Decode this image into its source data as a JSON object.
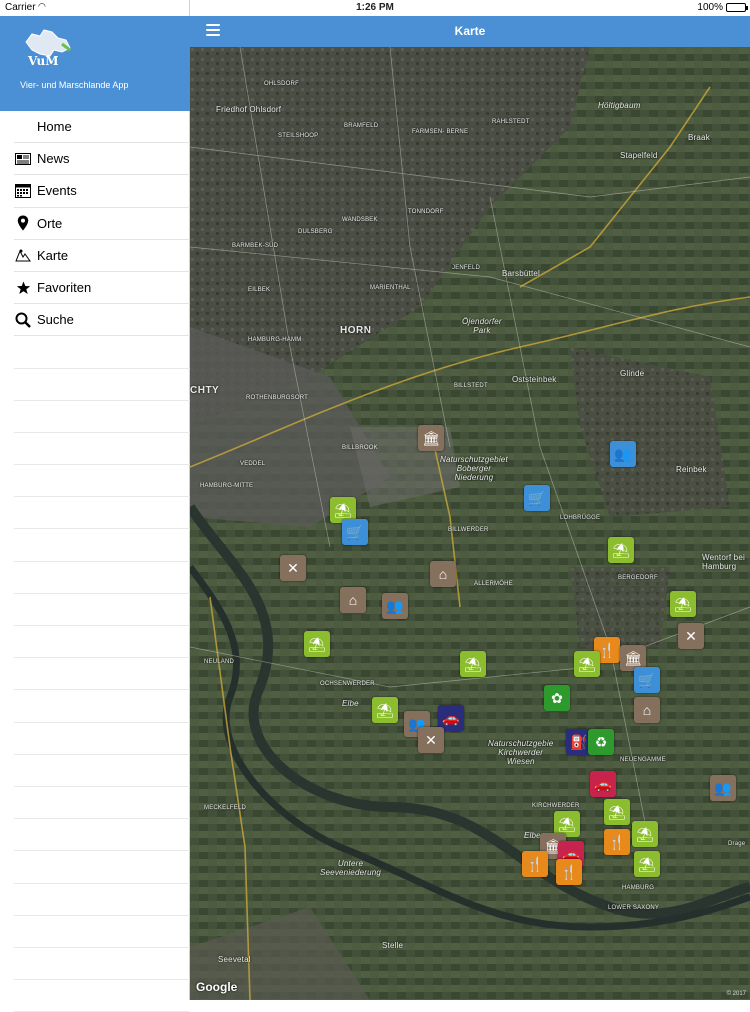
{
  "status": {
    "carrier": "Carrier",
    "time": "1:26 PM",
    "battery": "100%"
  },
  "sidebar": {
    "logo_text": "VuM",
    "subtitle": "Vier- und Marschlande App",
    "items": [
      {
        "label": "Home",
        "icon": "home"
      },
      {
        "label": "News",
        "icon": "newspaper-icon"
      },
      {
        "label": "Events",
        "icon": "calendar-icon"
      },
      {
        "label": "Orte",
        "icon": "location-pin-icon"
      },
      {
        "label": "Karte",
        "icon": "map-icon"
      },
      {
        "label": "Favoriten",
        "icon": "star-icon"
      },
      {
        "label": "Suche",
        "icon": "search-icon"
      }
    ]
  },
  "navbar": {
    "title": "Karte"
  },
  "map": {
    "attribution": "Google",
    "copyright": "© 2017",
    "labels": {
      "ohlsdorf": "OHLSDORF",
      "friedhof": "Friedhof Ohlsdorf",
      "steilshoop": "STEILSHOOP",
      "bramfeld": "BRAMFELD",
      "rahlstedt": "RAHLSTEDT",
      "farmsen": "FARMSEN-\nBERNE",
      "holtigbaum": "Höltigbaum",
      "braak": "Braak",
      "stapelfeld": "Stapelfeld",
      "wandsbek": "WANDSBEK",
      "tonndorf": "TONNDORF",
      "dulsberg": "DULSBERG",
      "barmbek": "BARMBEK-SÜD",
      "jenfeld": "JENFELD",
      "eilbek": "EILBEK",
      "marienthal": "MARIENTHAL",
      "barsbuttel": "Barsbüttel",
      "horn": "HORN",
      "hamm": "HAMBURG-HAMM",
      "ojendorfer": "Öjendorfer\nPark",
      "oststeinbek": "Oststeinbek",
      "glinde": "Glinde",
      "billstedt": "BILLSTEDT",
      "rothenburgsort": "ROTHENBURGSORT",
      "cihty": "CHTY",
      "billbrook": "BILLBROOK",
      "veddel": "VEDDEL",
      "hamburgmitte": "HAMBURG-MITTE",
      "naturschutz1": "Naturschutzgebiet\nBoberger\nNiederung",
      "reinbek": "Reinbek",
      "lohbrugge": "LOHBRÜGGE",
      "billwerder": "BILLWERDER",
      "wentorf": "Wentorf bei\nHamburg",
      "bergedorf": "BERGEDORF",
      "allermohe": "ALLERMÖHE",
      "neuland": "NEULAND",
      "ochsenwerder": "OCHSENWERDER",
      "naturschutz2": "Naturschutzgebie\nKirchwerder\nWiesen",
      "neuengamme": "NEUENGAMME",
      "meckelfeld": "MECKELFELD",
      "kirchwerder": "KIRCHWERDER",
      "untere": "Untere\nSeeveniederung",
      "hamburg": "HAMBURG",
      "lowersaxony": "LOWER SAXONY",
      "stelle": "Stelle",
      "seevetal": "Seevetal",
      "elbe1": "Elbe",
      "elbe2": "Elbe",
      "drage": "Drage"
    }
  },
  "colors": {
    "accent": "#4b8fd5",
    "marker_green": "#8cbd2e",
    "marker_brown": "#84705d",
    "marker_blue": "#3d8fd8"
  }
}
